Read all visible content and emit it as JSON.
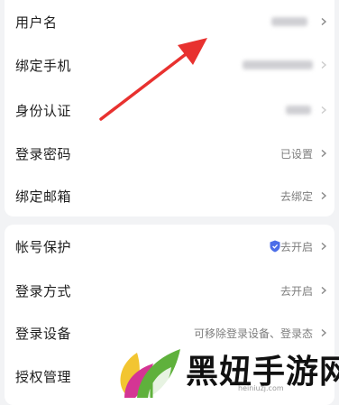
{
  "account_section": {
    "rows": [
      {
        "label": "用户名",
        "value": ""
      },
      {
        "label": "绑定手机",
        "value": ""
      },
      {
        "label": "身份认证",
        "value": ""
      },
      {
        "label": "登录密码",
        "value": "已设置"
      },
      {
        "label": "绑定邮箱",
        "value": "去绑定"
      }
    ]
  },
  "security_section": {
    "rows": [
      {
        "label": "帐号保护",
        "value": "去开启",
        "icon": "shield-icon"
      },
      {
        "label": "登录方式",
        "value": "去开启"
      },
      {
        "label": "登录设备",
        "value": "可移除登录设备、登录态"
      },
      {
        "label": "授权管理",
        "value": ""
      }
    ]
  },
  "annotation": {
    "arrow_color": "#e8312f"
  },
  "watermark": {
    "text": "黑妞手游网",
    "sub": "heiniuzj.com"
  },
  "colors": {
    "accent_blue": "#4c6ee8",
    "arrow": "#e8312f"
  }
}
